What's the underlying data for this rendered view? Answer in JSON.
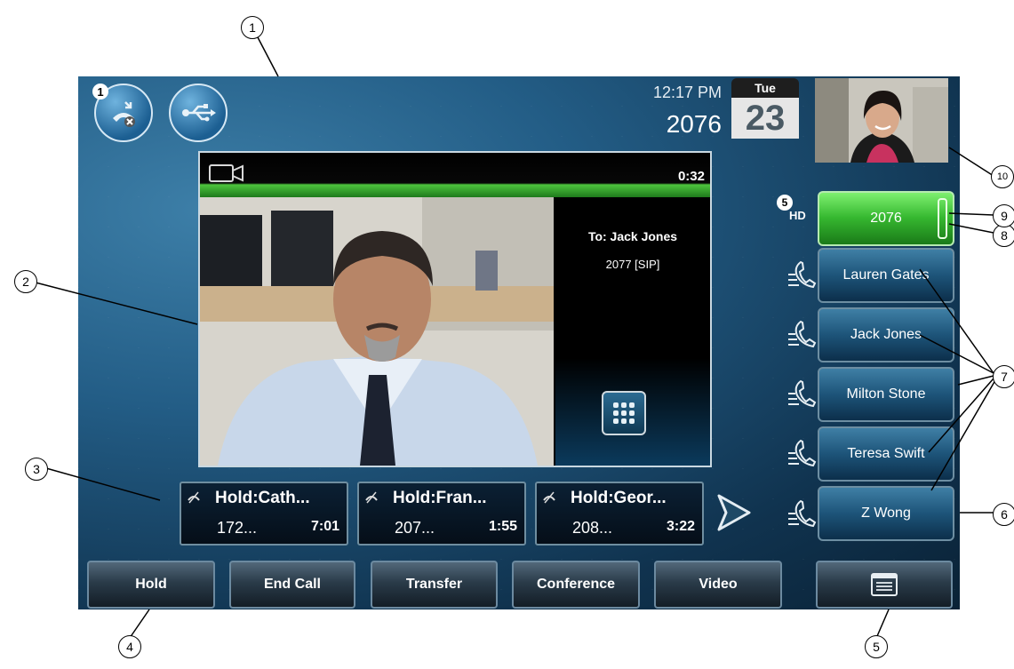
{
  "status": {
    "time": "12:17 PM",
    "extension": "2076",
    "calendar_day": "Tue",
    "calendar_date": "23",
    "missed_calls_count": "1"
  },
  "video_call": {
    "timer": "0:32",
    "to_label": "To: Jack Jones",
    "to_number": "2077 [SIP]"
  },
  "line_keys": {
    "hd_badge": "5",
    "primary": "2076",
    "contacts": [
      "Lauren Gates",
      "Jack Jones",
      "Milton Stone",
      "Teresa Swift",
      "Z Wong"
    ]
  },
  "held_calls": [
    {
      "name": "Hold:Cath...",
      "number": "172...",
      "time": "7:01"
    },
    {
      "name": "Hold:Fran...",
      "number": "207...",
      "time": "1:55"
    },
    {
      "name": "Hold:Geor...",
      "number": "208...",
      "time": "3:22"
    }
  ],
  "soft_keys": [
    "Hold",
    "End Call",
    "Transfer",
    "Conference",
    "Video"
  ],
  "callouts": [
    "1",
    "2",
    "3",
    "4",
    "5",
    "6",
    "7",
    "8",
    "9",
    "10"
  ],
  "colors": {
    "screen_bg": "#1c4f75",
    "active_line": "#36b830"
  },
  "icons": [
    "missed-call-icon",
    "usb-icon",
    "video-camera-icon",
    "dialpad-icon",
    "hold-muted-icon",
    "right-arrow-icon",
    "handset-icon",
    "hd-audio-icon",
    "menu-icon"
  ]
}
